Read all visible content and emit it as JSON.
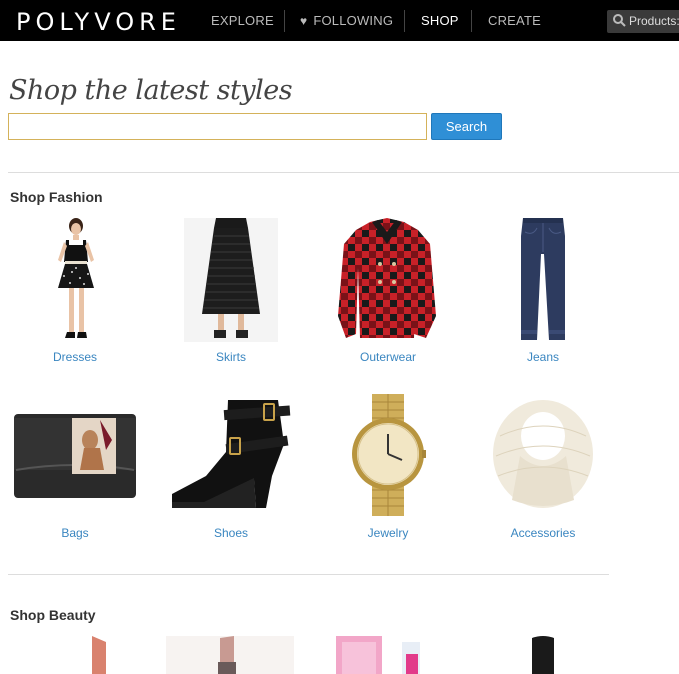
{
  "header": {
    "logo": "POLYVORE",
    "nav": {
      "explore": "EXPLORE",
      "following": "FOLLOWING",
      "shop": "SHOP",
      "create": "CREATE"
    },
    "search_placeholder": "Products:"
  },
  "main": {
    "heading": "Shop the latest styles",
    "search_value": "",
    "search_button": "Search"
  },
  "fashion": {
    "title": "Shop Fashion",
    "items": [
      {
        "label": "Dresses",
        "icon": "dress-image"
      },
      {
        "label": "Skirts",
        "icon": "skirt-image"
      },
      {
        "label": "Outerwear",
        "icon": "plaid-coat-image"
      },
      {
        "label": "Jeans",
        "icon": "jeans-image"
      },
      {
        "label": "Bags",
        "icon": "clutch-bag-image"
      },
      {
        "label": "Shoes",
        "icon": "ankle-boot-image"
      },
      {
        "label": "Jewelry",
        "icon": "gold-watch-image"
      },
      {
        "label": "Accessories",
        "icon": "knit-scarf-image"
      }
    ]
  },
  "beauty": {
    "title": "Shop Beauty"
  },
  "colors": {
    "nav_bg": "#000000",
    "link": "#3a86c0",
    "button": "#2f8fd6",
    "input_border": "#d4b25a"
  }
}
